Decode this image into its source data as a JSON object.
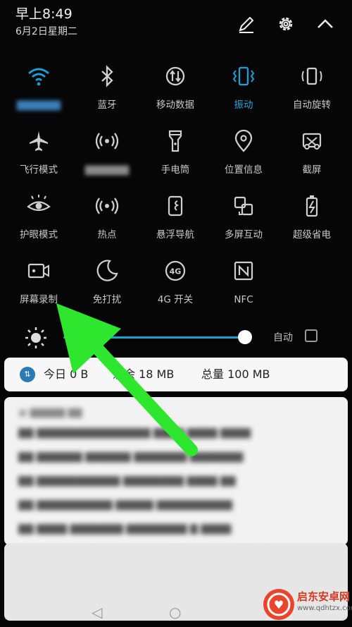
{
  "status": {
    "time": "早上8:49",
    "date": "6月2日星期二"
  },
  "top_actions": {
    "edit_icon": "pencil-icon",
    "settings_icon": "gear-icon",
    "collapse_icon": "chevron-up-icon"
  },
  "tiles": [
    {
      "label": "",
      "icon": "wifi-icon",
      "active": true,
      "blurred": true
    },
    {
      "label": "蓝牙",
      "icon": "bluetooth-icon"
    },
    {
      "label": "移动数据",
      "icon": "mobile-data-icon"
    },
    {
      "label": "振动",
      "icon": "vibrate-icon",
      "active": true
    },
    {
      "label": "自动旋转",
      "icon": "rotate-icon"
    },
    {
      "label": "飞行模式",
      "icon": "airplane-icon"
    },
    {
      "label": "",
      "icon": "hotspot-icon",
      "blurred": true
    },
    {
      "label": "手电筒",
      "icon": "flashlight-icon"
    },
    {
      "label": "位置信息",
      "icon": "location-icon"
    },
    {
      "label": "截屏",
      "icon": "screenshot-icon"
    },
    {
      "label": "护眼模式",
      "icon": "eye-icon"
    },
    {
      "label": "热点",
      "icon": "hotspot-icon"
    },
    {
      "label": "悬浮导航",
      "icon": "float-nav-icon"
    },
    {
      "label": "多屏互动",
      "icon": "multiscreen-icon"
    },
    {
      "label": "超级省电",
      "icon": "battery-icon"
    },
    {
      "label": "屏幕录制",
      "icon": "screen-record-icon"
    },
    {
      "label": "免打扰",
      "icon": "moon-icon"
    },
    {
      "label": "4G 开关",
      "icon": "4g-icon"
    },
    {
      "label": "NFC",
      "icon": "nfc-icon"
    }
  ],
  "brightness": {
    "level": 0.9,
    "auto_label": "自动",
    "auto_checked": false
  },
  "traffic": {
    "today": "今日 0 B",
    "remaining": "剩余 18 MB",
    "total": "总量 100 MB"
  },
  "colors": {
    "accent": "#1aa0d6",
    "arrow": "#2ee62e",
    "background": "#060606"
  }
}
